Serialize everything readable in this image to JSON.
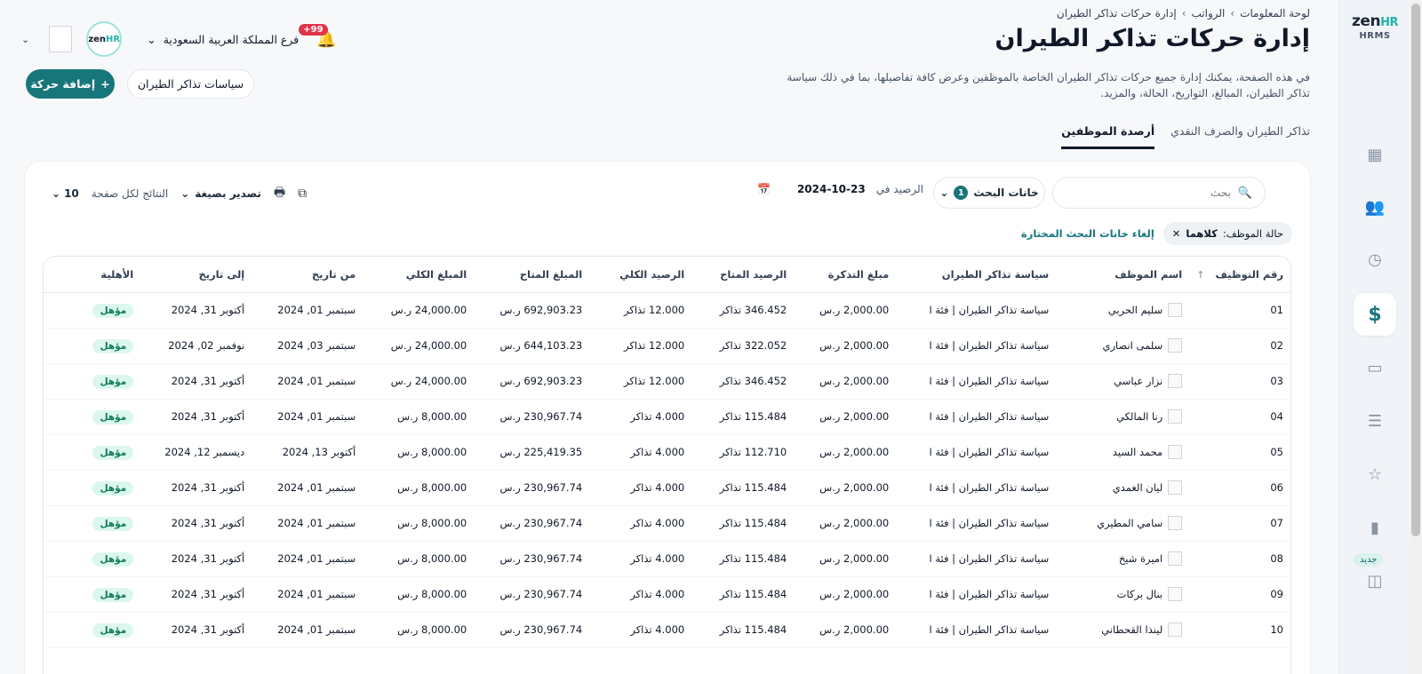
{
  "brand": {
    "zen": "zen",
    "hr": "HR",
    "sub": "HRMS"
  },
  "sidebar": {
    "items": [
      {
        "name": "dashboard-icon",
        "glyph": "▦"
      },
      {
        "name": "users-icon",
        "glyph": "👥"
      },
      {
        "name": "clock-icon",
        "glyph": "◷"
      },
      {
        "name": "dollar-icon",
        "glyph": "$"
      },
      {
        "name": "folder-icon",
        "glyph": "▭"
      },
      {
        "name": "list-icon",
        "glyph": "☰"
      },
      {
        "name": "star-icon",
        "glyph": "☆"
      },
      {
        "name": "chart-icon",
        "glyph": "▮"
      },
      {
        "name": "bag-icon",
        "glyph": "◫"
      }
    ],
    "new_badge": "جديد"
  },
  "header": {
    "branch": "فرع المملكة العربية السعودية",
    "notifications": "+99"
  },
  "breadcrumb": [
    "لوحة المعلومات",
    "الرواتب",
    "إدارة حركات تذاكر الطيران"
  ],
  "page": {
    "title": "إدارة حركات تذاكر الطيران",
    "description": "في هذه الصفحة، يمكنك إدارة جميع حركات تذاكر الطيران الخاصة بالموظفين وعرض كافة تفاصيلها، بما في ذلك سياسة تذاكر الطيران، المبالغ، التواريخ، الحالة، والمزيد.",
    "add_button": "إضافة حركة",
    "policy_button": "سياسات تذاكر الطيران"
  },
  "tabs": [
    {
      "label": "تذاكر الطيران والصرف النقدي",
      "active": false
    },
    {
      "label": "أرصدة الموظفين",
      "active": true
    }
  ],
  "toolbar": {
    "search_placeholder": "بحث",
    "filter_label": "خانات البحث",
    "filter_count": "1",
    "balance_label": "الرصيد في",
    "balance_date": "2024-10-23",
    "per_page_label": "النتائج لكل صفحة",
    "per_page_value": "10",
    "export_label": "تصدير بصيغة"
  },
  "filters": {
    "chip_label": "حالة الموظف:",
    "chip_value": "كلاهما",
    "clear": "إلغاء خانات البحث المختارة"
  },
  "table": {
    "columns": [
      "رقم التوظيف",
      "اسم الموظف",
      "سياسة تذاكر الطيران",
      "مبلغ التذكرة",
      "الرصيد المتاح",
      "الرصيد الكلي",
      "المبلغ المتاح",
      "المبلغ الكلي",
      "من تاريخ",
      "إلى تاريخ",
      "الأهلية"
    ],
    "rows": [
      {
        "id": "01",
        "name": "سليم الحربي",
        "policy": "سياسة تذاكر الطيران | فئة ا",
        "ticket": "2,000.00 ر.س",
        "avail_bal": "346.452 تذاكر",
        "total_bal": "12.000 تذاكر",
        "avail_amt": "692,903.23 ر.س",
        "total_amt": "24,000.00 ر.س",
        "from": "سبتمبر 01, 2024",
        "to": "أكتوبر 31, 2024",
        "status": "مؤهل"
      },
      {
        "id": "02",
        "name": "سلمى انصاري",
        "policy": "سياسة تذاكر الطيران | فئة ا",
        "ticket": "2,000.00 ر.س",
        "avail_bal": "322.052 تذاكر",
        "total_bal": "12.000 تذاكر",
        "avail_amt": "644,103.23 ر.س",
        "total_amt": "24,000.00 ر.س",
        "from": "سبتمبر 03, 2024",
        "to": "نوفمبر 02, 2024",
        "status": "مؤهل"
      },
      {
        "id": "03",
        "name": "نزار عباسي",
        "policy": "سياسة تذاكر الطيران | فئة ا",
        "ticket": "2,000.00 ر.س",
        "avail_bal": "346.452 تذاكر",
        "total_bal": "12.000 تذاكر",
        "avail_amt": "692,903.23 ر.س",
        "total_amt": "24,000.00 ر.س",
        "from": "سبتمبر 01, 2024",
        "to": "أكتوبر 31, 2024",
        "status": "مؤهل"
      },
      {
        "id": "04",
        "name": "رنا المالكي",
        "policy": "سياسة تذاكر الطيران | فئة ا",
        "ticket": "2,000.00 ر.س",
        "avail_bal": "115.484 تذاكر",
        "total_bal": "4.000 تذاكر",
        "avail_amt": "230,967.74 ر.س",
        "total_amt": "8,000.00 ر.س",
        "from": "سبتمبر 01, 2024",
        "to": "أكتوبر 31, 2024",
        "status": "مؤهل"
      },
      {
        "id": "05",
        "name": "محمد السيد",
        "policy": "سياسة تذاكر الطيران | فئة ا",
        "ticket": "2,000.00 ر.س",
        "avail_bal": "112.710 تذاكر",
        "total_bal": "4.000 تذاكر",
        "avail_amt": "225,419.35 ر.س",
        "total_amt": "8,000.00 ر.س",
        "from": "أكتوبر 13, 2024",
        "to": "ديسمبر 12, 2024",
        "status": "مؤهل"
      },
      {
        "id": "06",
        "name": "ليان الغمدي",
        "policy": "سياسة تذاكر الطيران | فئة ا",
        "ticket": "2,000.00 ر.س",
        "avail_bal": "115.484 تذاكر",
        "total_bal": "4.000 تذاكر",
        "avail_amt": "230,967.74 ر.س",
        "total_amt": "8,000.00 ر.س",
        "from": "سبتمبر 01, 2024",
        "to": "أكتوبر 31, 2024",
        "status": "مؤهل"
      },
      {
        "id": "07",
        "name": "سامي المطيري",
        "policy": "سياسة تذاكر الطيران | فئة ا",
        "ticket": "2,000.00 ر.س",
        "avail_bal": "115.484 تذاكر",
        "total_bal": "4.000 تذاكر",
        "avail_amt": "230,967.74 ر.س",
        "total_amt": "8,000.00 ر.س",
        "from": "سبتمبر 01, 2024",
        "to": "أكتوبر 31, 2024",
        "status": "مؤهل"
      },
      {
        "id": "08",
        "name": "اميرة شيخ",
        "policy": "سياسة تذاكر الطيران | فئة ا",
        "ticket": "2,000.00 ر.س",
        "avail_bal": "115.484 تذاكر",
        "total_bal": "4.000 تذاكر",
        "avail_amt": "230,967.74 ر.س",
        "total_amt": "8,000.00 ر.س",
        "from": "سبتمبر 01, 2024",
        "to": "أكتوبر 31, 2024",
        "status": "مؤهل"
      },
      {
        "id": "09",
        "name": "بنال بركات",
        "policy": "سياسة تذاكر الطيران | فئة ا",
        "ticket": "2,000.00 ر.س",
        "avail_bal": "115.484 تذاكر",
        "total_bal": "4.000 تذاكر",
        "avail_amt": "230,967.74 ر.س",
        "total_amt": "8,000.00 ر.س",
        "from": "سبتمبر 01, 2024",
        "to": "أكتوبر 31, 2024",
        "status": "مؤهل"
      },
      {
        "id": "10",
        "name": "لينذا القحطاني",
        "policy": "سياسة تذاكر الطيران | فئة ا",
        "ticket": "2,000.00 ر.س",
        "avail_bal": "115.484 تذاكر",
        "total_bal": "4.000 تذاكر",
        "avail_amt": "230,967.74 ر.س",
        "total_amt": "8,000.00 ر.س",
        "from": "سبتمبر 01, 2024",
        "to": "أكتوبر 31, 2024",
        "status": "مؤهل"
      }
    ]
  },
  "colors": {
    "primary": "#17767a",
    "accent": "#24b3a8",
    "badge": "#e0344b",
    "eligible_bg": "#dcf7ee"
  }
}
